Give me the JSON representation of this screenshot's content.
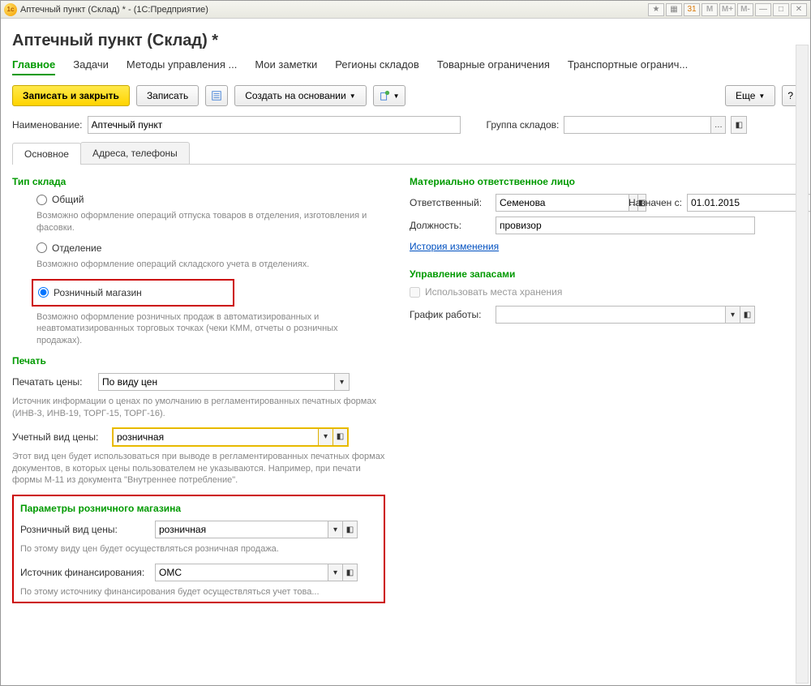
{
  "titlebar": {
    "title": "Аптечный пункт (Склад) * - (1С:Предприятие)",
    "mem_buttons": [
      "M",
      "M+",
      "M-"
    ]
  },
  "page": {
    "title": "Аптечный пункт (Склад) *"
  },
  "main_tabs": {
    "items": [
      "Главное",
      "Задачи",
      "Методы управления ...",
      "Мои заметки",
      "Регионы складов",
      "Товарные ограничения",
      "Транспортные огранич..."
    ],
    "active_index": 0
  },
  "toolbar": {
    "save_close": "Записать и закрыть",
    "save": "Записать",
    "create_based": "Создать на основании",
    "more": "Еще",
    "help": "?"
  },
  "fields": {
    "name_label": "Наименование:",
    "name_value": "Аптечный пункт",
    "group_label": "Группа складов:",
    "group_value": ""
  },
  "subtabs": {
    "main": "Основное",
    "addresses": "Адреса, телефоны"
  },
  "warehouse_type": {
    "title": "Тип склада",
    "general": "Общий",
    "general_hint": "Возможно оформление операций отпуска товаров в отделения, изготовления и фасовки.",
    "department": "Отделение",
    "department_hint": "Возможно оформление операций складского учета в отделениях.",
    "retail": "Розничный магазин",
    "retail_hint": "Возможно оформление розничных продаж в автоматизированных и неавтоматизированных торговых точках (чеки КММ, отчеты о розничных продажах)."
  },
  "print": {
    "title": "Печать",
    "print_prices_label": "Печатать цены:",
    "print_prices_value": "По виду цен",
    "print_prices_hint": "Источник информации о ценах по умолчанию в регламентированных печатных формах (ИНВ-3, ИНВ-19, ТОРГ-15, ТОРГ-16).",
    "acct_price_label": "Учетный вид цены:",
    "acct_price_value": "розничная",
    "acct_price_hint": "Этот вид цен будет использоваться при выводе в регламентированных печатных формах документов, в которых цены пользователем не указываются. Например, при печати формы М-11 из документа \"Внутреннее потребление\"."
  },
  "retail_params": {
    "title": "Параметры розничного магазина",
    "price_type_label": "Розничный вид цены:",
    "price_type_value": "розничная",
    "price_type_hint": "По этому виду цен будет осуществляться розничная продажа.",
    "fin_source_label": "Источник финансирования:",
    "fin_source_value": "ОМС",
    "fin_source_hint": "По этому источнику финансирования будет осуществляться учет това..."
  },
  "responsible": {
    "title": "Материально ответственное лицо",
    "resp_label": "Ответственный:",
    "resp_value": "Семенова",
    "date_label": "Назначен с:",
    "date_value": "01.01.2015",
    "position_label": "Должность:",
    "position_value": "провизор",
    "history_link": "История изменения"
  },
  "stock": {
    "title": "Управление запасами",
    "use_storage": "Использовать места хранения",
    "schedule_label": "График работы:",
    "schedule_value": ""
  }
}
